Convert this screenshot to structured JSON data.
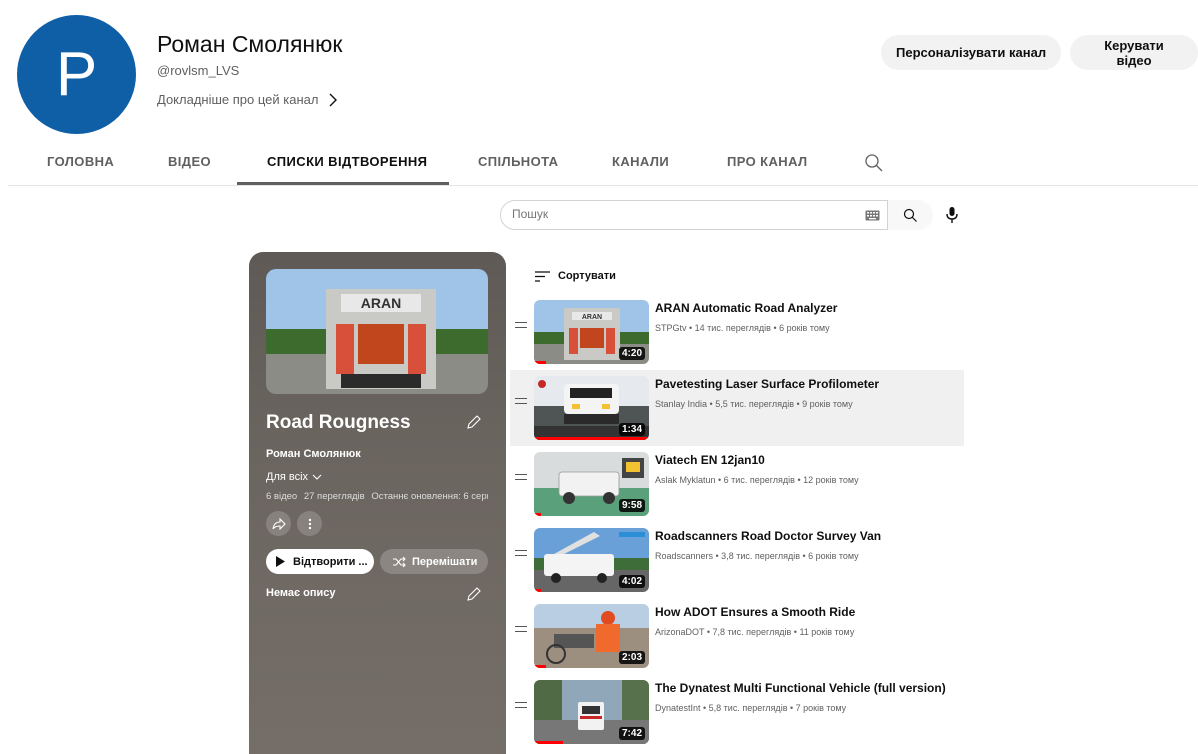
{
  "channel": {
    "avatar_letter": "P",
    "avatar_color": "#0f5fa6",
    "name": "Роман Смолянюк",
    "handle": "@rovlsm_LVS",
    "more_link": "Докладніше про цей канал",
    "customize_button": "Персоналізувати канал",
    "manage_button": "Керувати відео"
  },
  "tabs": [
    {
      "label": "Головна",
      "active": false
    },
    {
      "label": "Відео",
      "active": false
    },
    {
      "label": "Списки відтворення",
      "active": true
    },
    {
      "label": "Спільнота",
      "active": false
    },
    {
      "label": "Канали",
      "active": false
    },
    {
      "label": "Про канал",
      "active": false
    }
  ],
  "search": {
    "placeholder": "Пошук"
  },
  "playlist": {
    "title": "Road Rougness",
    "owner": "Роман Смолянюк",
    "privacy": "Для всіх",
    "video_count": "6 відео",
    "views": "27 переглядів",
    "updated": "Останнє оновлення: 6 серп...",
    "play_button": "Відтворити ...",
    "shuffle_button": "Перемішати",
    "description": "Немає опису"
  },
  "sort_label": "Сортувати",
  "videos": [
    {
      "title": "ARAN Automatic Road Analyzer",
      "meta": "STPGtv • 14 тис. переглядів • 6 років тому",
      "duration": "4:20",
      "progress": 0.1,
      "highlighted": false
    },
    {
      "title": "Pavetesting Laser Surface Profilometer",
      "meta": "Stanlay India • 5,5 тис. переглядів • 9 років тому",
      "duration": "1:34",
      "progress": 1.0,
      "highlighted": true
    },
    {
      "title": "Viatech EN 12jan10",
      "meta": "Aslak Myklatun • 6 тис. переглядів • 12 років тому",
      "duration": "9:58",
      "progress": 0.06,
      "highlighted": false
    },
    {
      "title": "Roadscanners Road Doctor Survey Van",
      "meta": "Roadscanners • 3,8 тис. переглядів • 6 років тому",
      "duration": "4:02",
      "progress": 0.06,
      "highlighted": false
    },
    {
      "title": "How ADOT Ensures a Smooth Ride",
      "meta": "ArizonaDOT • 7,8 тис. переглядів • 11 років тому",
      "duration": "2:03",
      "progress": 0.1,
      "highlighted": false
    },
    {
      "title": "The Dynatest Multi Functional Vehicle (full version)",
      "meta": "DynatestInt • 5,8 тис. переглядів • 7 років тому",
      "duration": "7:42",
      "progress": 0.25,
      "highlighted": false
    }
  ]
}
